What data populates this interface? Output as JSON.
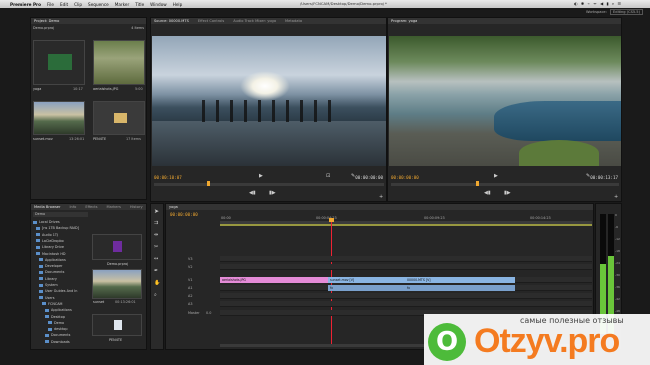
{
  "menubar": {
    "apple": "",
    "items": [
      "Premiere Pro",
      "File",
      "Edit",
      "Clip",
      "Sequence",
      "Marker",
      "Title",
      "Window",
      "Help"
    ],
    "window_title": "/Users/FCNCAM/Desktop/Demo/Demo.prproj *",
    "right_icons": "◐ ✱ ⌁ ᯤ ◀ ▮ ⌕ ☰"
  },
  "workspace": {
    "label": "Workspace:",
    "value": "Editing (CS5.5)"
  },
  "project": {
    "tab": "Project: Demo",
    "file": "Demo.prproj",
    "count": "4 Items",
    "items": [
      {
        "name": "yoga",
        "dur": "10:17"
      },
      {
        "name": "aerialshots.JPG",
        "dur": "5:00"
      },
      {
        "name": "sunset.mov",
        "dur": "13:26:01"
      },
      {
        "name": "PEN4TE",
        "dur": "17 Items"
      }
    ]
  },
  "source": {
    "tabs": [
      "Source: 00000.MTS",
      "Effect Controls",
      "Audio Track Mixer: yoga",
      "Metadata"
    ],
    "tc_left": "00:00:10:07",
    "tc_right": "00:00:00:00"
  },
  "program": {
    "tab": "Program: yoga",
    "tc_left": "00:00:00:00",
    "tc_right": "00:00:13:17"
  },
  "media": {
    "tabs": [
      "Media Browser",
      "Info",
      "Effects",
      "Markers",
      "History"
    ],
    "drive_label": "Demo",
    "tree": [
      "Local Drives",
      "[ns 1TB Backup RAID]",
      "Audio 1TJ",
      "LaCieDropbo",
      "Library Drive",
      "Macintosh HD",
      "Applications",
      "Developer",
      "Documents",
      "Library",
      "System",
      "User Guides And In",
      "Users",
      "FCNCAM",
      "Applications",
      "Desktop",
      "Demo",
      "desktop",
      "Documents",
      "Downloads"
    ],
    "thumbs": [
      {
        "name": "Demo.prproj"
      },
      {
        "name": "sunset",
        "dur": "00:13:26:01"
      },
      {
        "name": "PEN4TE"
      }
    ]
  },
  "timeline": {
    "tab": "yoga",
    "tc": "00:00:00:00",
    "ruler": [
      "00:00",
      "00:00:04:23",
      "00:00:09:23",
      "00:00:14:23"
    ],
    "tracks": [
      "V3",
      "V2",
      "V1",
      "A1",
      "A2",
      "A3",
      "Master"
    ],
    "master_val": "0.0",
    "clips": [
      "aerialshots.JPG",
      "sunset.mov [V]",
      "00000.MTS [V]",
      "fx",
      "fx"
    ]
  },
  "meter_ticks": [
    "0",
    "-6",
    "-12",
    "-18",
    "-24",
    "-30",
    "-36",
    "-42",
    "-48",
    "-54"
  ],
  "watermark": {
    "slogan": "самые полезные отзывы",
    "site": "Otzyv.pro",
    "o": "O"
  },
  "colors": {
    "orange": "#f0a830",
    "pink": "#e58cd8",
    "blue": "#8ab5e3",
    "green": "#6ac53a"
  }
}
